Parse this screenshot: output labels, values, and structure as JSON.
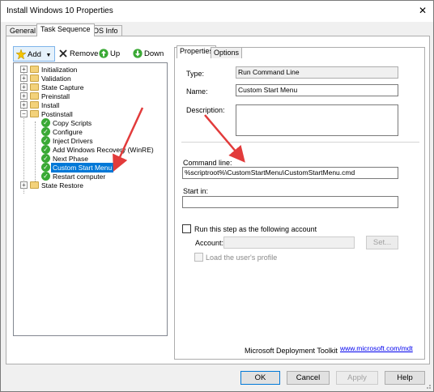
{
  "window": {
    "title": "Install Windows 10 Properties",
    "close_glyph": "✕"
  },
  "tabs": [
    {
      "label": "General"
    },
    {
      "label": "Task Sequence"
    },
    {
      "label": "OS Info"
    }
  ],
  "toolbar": {
    "add_label": "Add",
    "remove_label": "Remove",
    "up_label": "Up",
    "down_label": "Down"
  },
  "tree": {
    "nodes": [
      {
        "label": "Initialization",
        "kind": "group",
        "expander": "+"
      },
      {
        "label": "Validation",
        "kind": "group",
        "expander": "+"
      },
      {
        "label": "State Capture",
        "kind": "group",
        "expander": "+"
      },
      {
        "label": "Preinstall",
        "kind": "group",
        "expander": "+"
      },
      {
        "label": "Install",
        "kind": "group",
        "expander": "+"
      },
      {
        "label": "Postinstall",
        "kind": "group",
        "expander": "−"
      },
      {
        "label": "Copy Scripts",
        "kind": "step"
      },
      {
        "label": "Configure",
        "kind": "step"
      },
      {
        "label": "Inject Drivers",
        "kind": "step"
      },
      {
        "label": "Add Windows Recovery (WinRE)",
        "kind": "step"
      },
      {
        "label": "Next Phase",
        "kind": "step"
      },
      {
        "label": "Custom Start Menu",
        "kind": "step",
        "selected": true
      },
      {
        "label": "Restart computer",
        "kind": "step"
      },
      {
        "label": "State Restore",
        "kind": "group",
        "expander": "+"
      }
    ]
  },
  "properties": {
    "tabs": [
      {
        "label": "Properties"
      },
      {
        "label": "Options"
      }
    ],
    "type_label": "Type:",
    "type_value": "Run Command Line",
    "name_label": "Name:",
    "name_value": "Custom Start Menu",
    "description_label": "Description:",
    "description_value": "",
    "command_line_label": "Command line:",
    "command_line_value": "%scriptroot%\\CustomStartMenu\\CustomStartMenu.cmd",
    "start_in_label": "Start in:",
    "start_in_value": "",
    "run_as_label": "Run this step as the following account",
    "account_label": "Account:",
    "account_value": "",
    "set_button": "Set...",
    "load_profile_label": "Load the user's profile",
    "footer_text": "Microsoft Deployment Toolkit",
    "footer_link": "www.microsoft.com/mdt"
  },
  "buttons": {
    "ok": "OK",
    "cancel": "Cancel",
    "apply": "Apply",
    "help": "Help"
  },
  "colors": {
    "accent": "#0078d7",
    "annotation_arrow": "#e23b3b",
    "success": "#3aa935"
  },
  "icons": {
    "add": "add-star-icon",
    "remove": "remove-x-icon",
    "up": "up-arrow-icon",
    "down": "down-arrow-icon",
    "folder": "folder-icon",
    "step": "green-check-icon"
  }
}
